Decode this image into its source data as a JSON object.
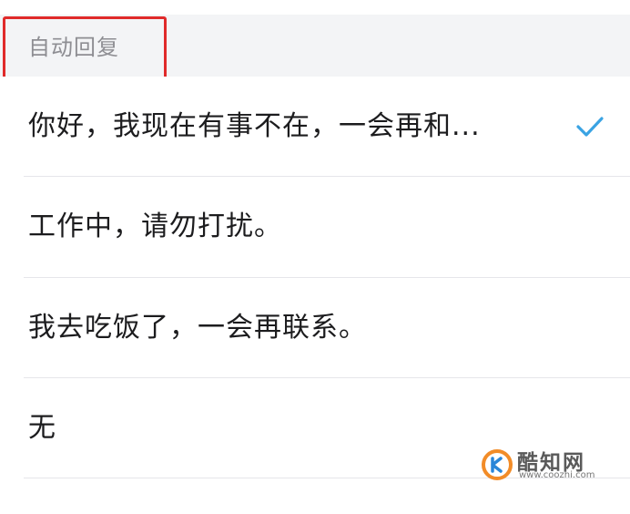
{
  "section": {
    "title": "自动回复"
  },
  "options": [
    {
      "label": "你好，我现在有事不在，一会再和...",
      "selected": true
    },
    {
      "label": "工作中，请勿打扰。",
      "selected": false
    },
    {
      "label": "我去吃饭了，一会再联系。",
      "selected": false
    },
    {
      "label": "无",
      "selected": false
    }
  ],
  "icons": {
    "selected_check": "checkmark-icon",
    "watermark_logo": "coozhi-logo-icon"
  },
  "watermark": {
    "name": "酷知网",
    "url": "www.coozhi.com"
  },
  "colors": {
    "check": "#3aa3e3",
    "highlight_border": "#e02a2a",
    "section_bg": "#f3f4f6",
    "section_text": "#8e8e93",
    "option_text": "#1c1c1e",
    "divider": "#e6e6ea"
  }
}
